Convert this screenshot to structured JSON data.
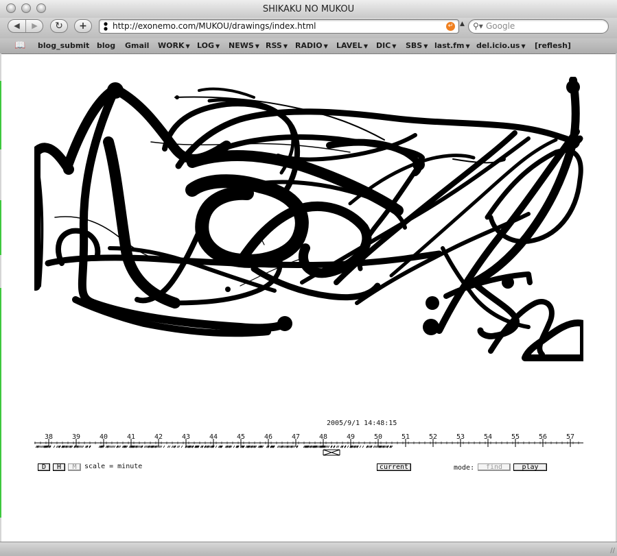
{
  "window": {
    "title": "SHIKAKU NO MUKOU"
  },
  "toolbar": {
    "back_icon": "back-arrow-icon",
    "forward_icon": "forward-arrow-icon",
    "reload_icon": "reload-icon",
    "add_icon": "add-bookmark-icon",
    "url": "http://exonemo.com/MUKOU/drawings/index.html",
    "search_placeholder": "Google"
  },
  "bookmarks": [
    {
      "label": "blog_submit",
      "menu": false
    },
    {
      "label": "blog",
      "menu": false
    },
    {
      "label": "Gmail",
      "menu": false
    },
    {
      "label": "WORK",
      "menu": true
    },
    {
      "label": "LOG",
      "menu": true
    },
    {
      "label": "NEWS",
      "menu": true
    },
    {
      "label": "RSS",
      "menu": true
    },
    {
      "label": "RADIO",
      "menu": true
    },
    {
      "label": "LAVEL",
      "menu": true
    },
    {
      "label": "DIC",
      "menu": true
    },
    {
      "label": "SBS",
      "menu": true
    },
    {
      "label": "last.fm",
      "menu": true
    },
    {
      "label": "del.icio.us",
      "menu": true
    },
    {
      "label": "[reflesh]",
      "menu": false
    }
  ],
  "timeline": {
    "timestamp": "2005/9/1 14:48:15",
    "ticks": [
      "38",
      "39",
      "40",
      "41",
      "42",
      "43",
      "44",
      "45",
      "46",
      "47",
      "48",
      "49",
      "50",
      "51",
      "52",
      "53",
      "54",
      "55",
      "56",
      "57"
    ],
    "selected_minute": 48.3,
    "scale_label": "scale = minute",
    "scale_buttons": [
      "D",
      "H",
      "M"
    ],
    "active_scale": "M",
    "current_button": "current",
    "mode_label": "mode:",
    "mode_buttons": [
      "find",
      "play"
    ],
    "active_mode": "find"
  },
  "colors": {
    "ink": "#000000",
    "paper": "#ffffff",
    "accent_green": "#3ec83e",
    "rss_orange": "#f08020"
  }
}
